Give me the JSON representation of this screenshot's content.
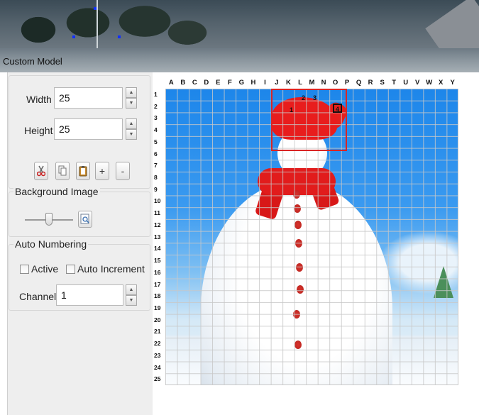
{
  "window": {
    "title": "Custom Model"
  },
  "size_panel": {
    "width_label": "Width",
    "width_value": "25",
    "height_label": "Height",
    "height_value": "25",
    "spin_up": "▲",
    "spin_down": "▼"
  },
  "toolbar": {
    "cut_icon": "scissors-icon",
    "copy_icon": "copy-icon",
    "paste_icon": "clipboard-icon",
    "add_label": "+",
    "remove_label": "-"
  },
  "background_panel": {
    "legend": "Background Image",
    "opacity_slider_value": 0.5,
    "browse_icon": "image-browse-icon"
  },
  "auto_numbering": {
    "legend": "Auto Numbering",
    "active_label": "Active",
    "active_checked": false,
    "auto_increment_label": "Auto Increment",
    "auto_increment_checked": false,
    "channel_label": "Channel",
    "channel_value": "1"
  },
  "grid": {
    "columns": [
      "A",
      "B",
      "C",
      "D",
      "E",
      "F",
      "G",
      "H",
      "I",
      "J",
      "K",
      "L",
      "M",
      "N",
      "O",
      "P",
      "Q",
      "R",
      "S",
      "T",
      "U",
      "V",
      "W",
      "X",
      "Y"
    ],
    "rows": [
      "1",
      "2",
      "3",
      "4",
      "5",
      "6",
      "7",
      "8",
      "9",
      "10",
      "11",
      "12",
      "13",
      "14",
      "15",
      "16",
      "17",
      "18",
      "19",
      "20",
      "21",
      "22",
      "23",
      "24",
      "25"
    ],
    "selection_numbers": [
      "1",
      "2",
      "3",
      "4"
    ],
    "colors": {
      "selection": "#d92525",
      "grid_line": "#c8c8c8"
    }
  }
}
